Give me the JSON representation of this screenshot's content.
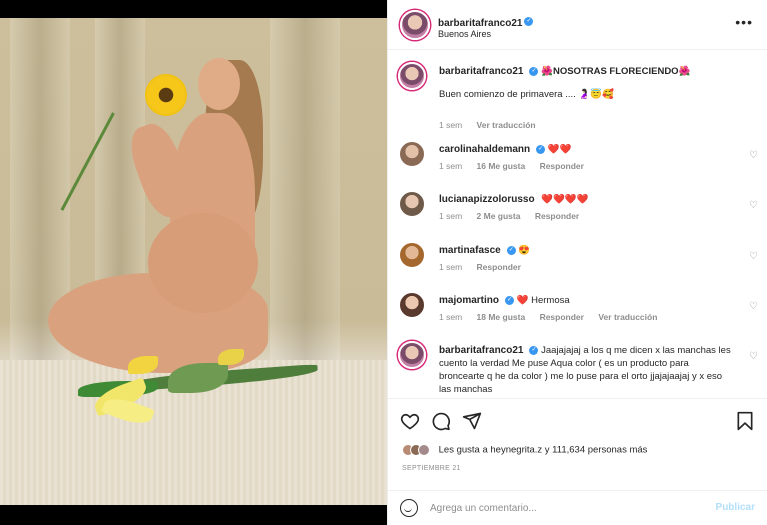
{
  "post": {
    "username": "barbaritafranco21",
    "location": "Buenos Aires",
    "more_icon": "more-options-icon",
    "caption": {
      "text_line1": "🌺NOSOTRAS FLORECIENDO🌺",
      "text_line2": "Buen comienzo de primavera .... 🤰🏻😇🥰",
      "time": "1 sem",
      "translate": "Ver traducción"
    }
  },
  "comments": [
    {
      "username": "carolinahaldemann",
      "text": "❤️❤️",
      "time": "1 sem",
      "likes": "16 Me gusta",
      "reply": "Responder"
    },
    {
      "username": "lucianapizzolorusso",
      "text": "❤️❤️❤️❤️",
      "time": "1 sem",
      "likes": "2 Me gusta",
      "reply": "Responder"
    },
    {
      "username": "martinafasce",
      "text": "😍",
      "time": "1 sem",
      "reply": "Responder"
    },
    {
      "username": "majomartino",
      "text": "❤️ Hermosa",
      "time": "1 sem",
      "likes": "18 Me gusta",
      "reply": "Responder",
      "translate": "Ver traducción"
    },
    {
      "username": "barbaritafranco21",
      "text": "Jaajajajaj a los q me dicen x las manchas les cuento la verdad Me puse Aqua color ( es un producto para broncearte q he da color ) me lo puse para el orto jjajajaajaj y x eso las manchas"
    }
  ],
  "actions": {
    "like_icon": "heart-icon",
    "comment_icon": "comment-icon",
    "share_icon": "send-icon",
    "save_icon": "bookmark-icon",
    "likes_text": "Les gusta a heynegrita.z y 111,634 personas más",
    "date": "SEPTIEMBRE 21"
  },
  "composer": {
    "emoji_icon": "smile-icon",
    "placeholder": "Agrega un comentario...",
    "publish_label": "Publicar"
  },
  "colors": {
    "verified": "#3897f0",
    "publish_disabled": "#b2dffc",
    "secondary_text": "#8e8e8e"
  }
}
